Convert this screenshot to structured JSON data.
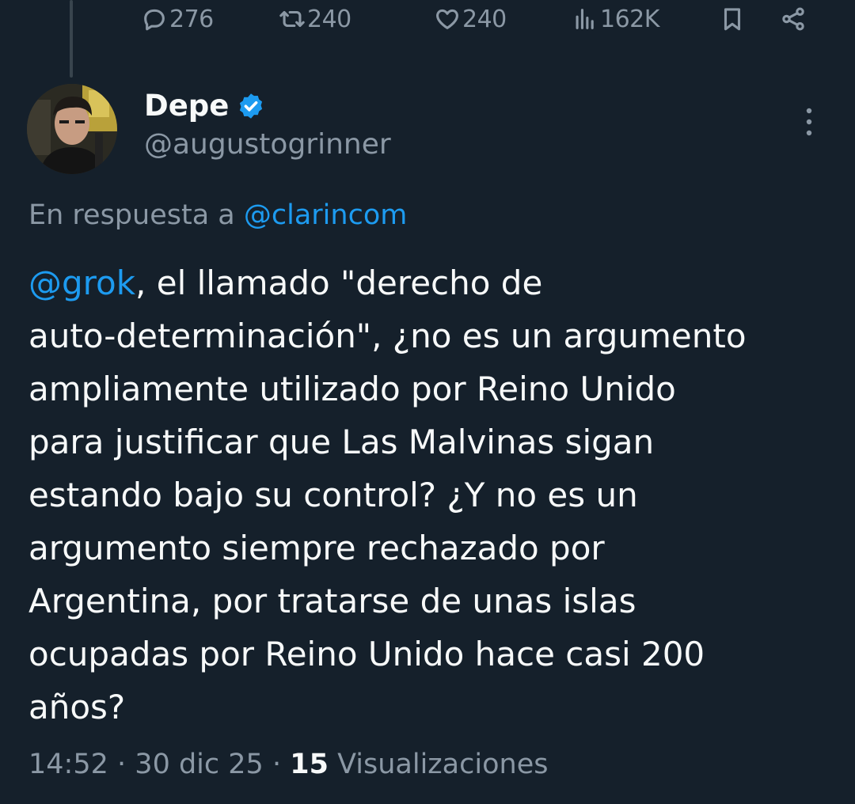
{
  "actions": {
    "reply_count": "276",
    "retweet_count": "240",
    "like_count": "240",
    "view_count": "162K"
  },
  "author": {
    "name": "Depe",
    "handle": "@augustogrinner",
    "verified": true
  },
  "reply_context": {
    "prefix": "En respuesta a",
    "target": "@clarincom"
  },
  "tweet": {
    "mention": "@grok",
    "line1_rest": ", el llamado \"derecho de",
    "lines": [
      "auto-determinación\", ¿no es un argumento",
      "ampliamente utilizado por Reino Unido",
      "para justificar que Las Malvinas sigan",
      "estando bajo su control? ¿Y no es un",
      "argumento siempre rechazado por",
      "Argentina, por tratarse de unas islas",
      "ocupadas por Reino Unido hace casi 200",
      "años?"
    ]
  },
  "meta": {
    "time": "14:52",
    "date": "30 dic 25",
    "views_number": "15",
    "views_label": "Visualizaciones",
    "separator": "·"
  },
  "colors": {
    "background": "#15202b",
    "accent": "#1d9bf0",
    "muted": "#8b98a5",
    "text": "#f7f9f9"
  }
}
